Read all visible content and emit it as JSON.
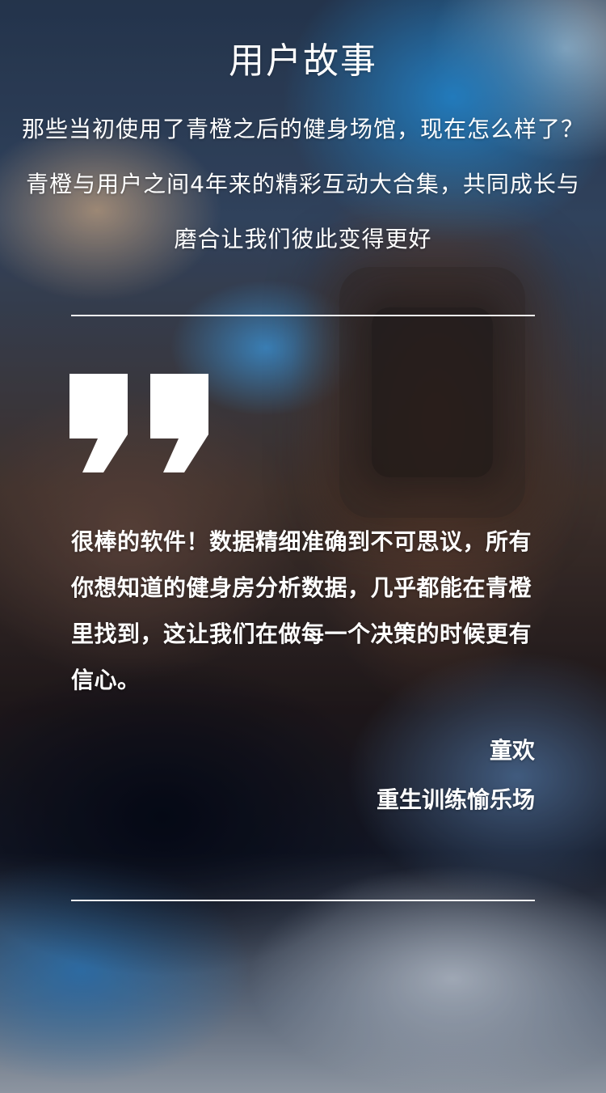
{
  "page": {
    "title": "用户故事",
    "intro": "那些当初使用了青橙之后的健身场馆，现在怎么样了？青橙与用户之间4年来的精彩互动大合集，共同成长与磨合让我们彼此变得更好"
  },
  "testimonial": {
    "quote_icon": "closing-quotation-mark-icon",
    "text": "很棒的软件！数据精细准确到不可思议，所有你想知道的健身房分析数据，几乎都能在青橙里找到，这让我们在做每一个决策的时候更有信心。",
    "author": "童欢",
    "organization": "重生训练愉乐场"
  },
  "colors": {
    "text": "#ffffff",
    "divider": "#ffffff"
  }
}
